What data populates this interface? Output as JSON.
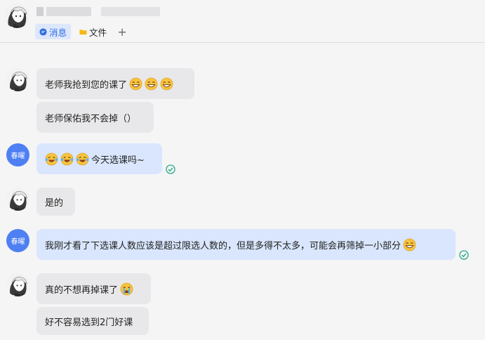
{
  "header": {
    "tabs": [
      {
        "label": "消息",
        "icon": "chat-bubble-icon",
        "active": true
      },
      {
        "label": "文件",
        "icon": "folder-icon",
        "active": false
      }
    ],
    "add_tab_label": "+"
  },
  "messages": [
    {
      "sender": "other",
      "text": "老师我抢到您的课了",
      "emojis": [
        "grin-emoji",
        "grin-emoji",
        "grin-emoji"
      ]
    },
    {
      "sender": "other",
      "text": "老师保佑我不会掉（）"
    },
    {
      "sender": "self",
      "avatar_text": "春曜",
      "text": "今天选课吗~",
      "emojis_before": [
        "laugh-cry-emoji",
        "laugh-cry-emoji",
        "laugh-cry-emoji"
      ],
      "read": true
    },
    {
      "sender": "other",
      "text": "是的"
    },
    {
      "sender": "self",
      "avatar_text": "春曜",
      "text": "我刚才看了下选课人数应该是超过限选人数的，但是多得不太多，可能会再筛掉一小部分",
      "emojis": [
        "grin-emoji"
      ],
      "read": true
    },
    {
      "sender": "other",
      "text": "真的不想再掉课了",
      "emojis": [
        "crying-emoji"
      ]
    },
    {
      "sender": "other",
      "text": "好不容易选到2门好课"
    }
  ],
  "colors": {
    "accent": "#2f6ce5",
    "self_bubble": "#d9e6fd",
    "other_bubble": "#e8e8ea",
    "read_check": "#2aa889"
  }
}
